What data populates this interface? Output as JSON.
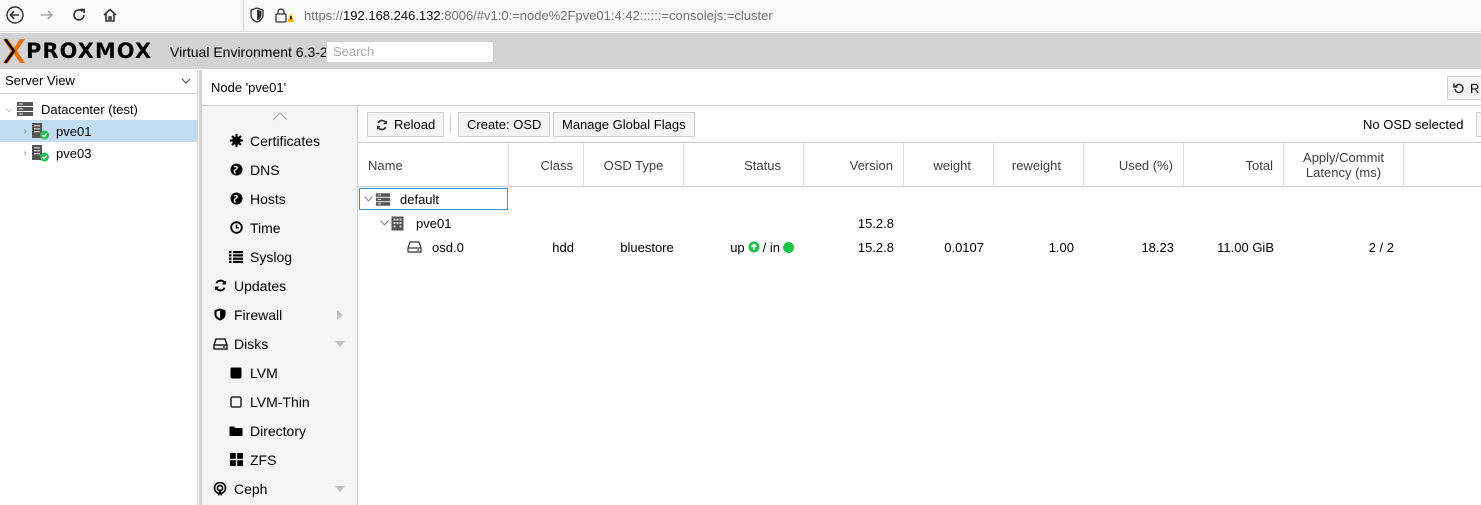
{
  "browser": {
    "url_prefix": "https://",
    "url_host": "192.168.246.132",
    "url_rest": ":8006/#v1:0:=node%2Fpve01:4:42::::::=consolejs:=cluster"
  },
  "header": {
    "logo_text": "PROXMOX",
    "product": "Virtual Environment 6.3-2",
    "search_placeholder": "Search"
  },
  "tree": {
    "view": "Server View",
    "datacenter": "Datacenter (test)",
    "nodes": [
      "pve01",
      "pve03"
    ]
  },
  "node": {
    "title": "Node 'pve01'",
    "right_button": "R"
  },
  "menu": {
    "items": [
      {
        "label": "Certificates",
        "icon": "gear-icon"
      },
      {
        "label": "DNS",
        "icon": "globe-icon"
      },
      {
        "label": "Hosts",
        "icon": "globe-icon"
      },
      {
        "label": "Time",
        "icon": "clock-icon"
      },
      {
        "label": "Syslog",
        "icon": "list-icon"
      },
      {
        "label": "Updates",
        "icon": "refresh-icon"
      },
      {
        "label": "Firewall",
        "icon": "shield-icon"
      },
      {
        "label": "Disks",
        "icon": "hdd-icon"
      },
      {
        "label": "LVM",
        "icon": "square-icon"
      },
      {
        "label": "LVM-Thin",
        "icon": "square-outline-icon"
      },
      {
        "label": "Directory",
        "icon": "folder-icon"
      },
      {
        "label": "ZFS",
        "icon": "grid-icon"
      },
      {
        "label": "Ceph",
        "icon": "ceph-icon"
      }
    ]
  },
  "toolbar": {
    "reload": "Reload",
    "create_osd": "Create: OSD",
    "manage_flags": "Manage Global Flags",
    "status": "No OSD selected"
  },
  "grid": {
    "columns": {
      "name": "Name",
      "class": "Class",
      "osd_type": "OSD Type",
      "status": "Status",
      "version": "Version",
      "weight": "weight",
      "reweight": "reweight",
      "used": "Used (%)",
      "total": "Total",
      "latency_1": "Apply/Commit",
      "latency_2": "Latency (ms)"
    },
    "root": {
      "name": "default"
    },
    "host": {
      "name": "pve01",
      "version": "15.2.8"
    },
    "osd": {
      "name": "osd.0",
      "class": "hdd",
      "osd_type": "bluestore",
      "status_up": "up",
      "status_sep": "/ in",
      "version": "15.2.8",
      "weight": "0.0107",
      "reweight": "1.00",
      "used": "18.23",
      "total": "11.00 GiB",
      "latency": "2 / 2"
    }
  }
}
